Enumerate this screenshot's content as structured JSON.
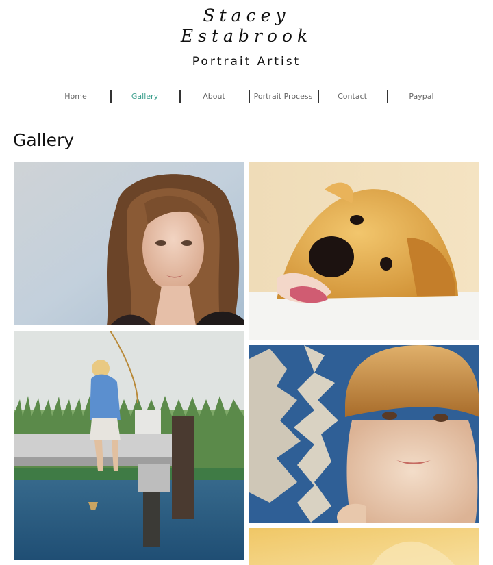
{
  "site": {
    "logo_line1": "Stacey",
    "logo_line2": "Estabrook",
    "tagline": "Portrait Artist"
  },
  "nav": {
    "items": [
      {
        "label": "Home",
        "active": false
      },
      {
        "label": "Gallery",
        "active": true
      },
      {
        "label": "About",
        "active": false
      },
      {
        "label": "Portrait Process",
        "active": false
      },
      {
        "label": "Contact",
        "active": false
      },
      {
        "label": "Paypal",
        "active": false
      }
    ],
    "active_color": "#3a9e8c"
  },
  "page": {
    "title": "Gallery"
  },
  "gallery": {
    "images": [
      {
        "subject": "portrait-woman-brown-hair"
      },
      {
        "subject": "portrait-golden-retriever"
      },
      {
        "subject": "boy-fishing-on-dock"
      },
      {
        "subject": "portrait-young-boy"
      },
      {
        "subject": "partially-visible-painting"
      }
    ]
  }
}
